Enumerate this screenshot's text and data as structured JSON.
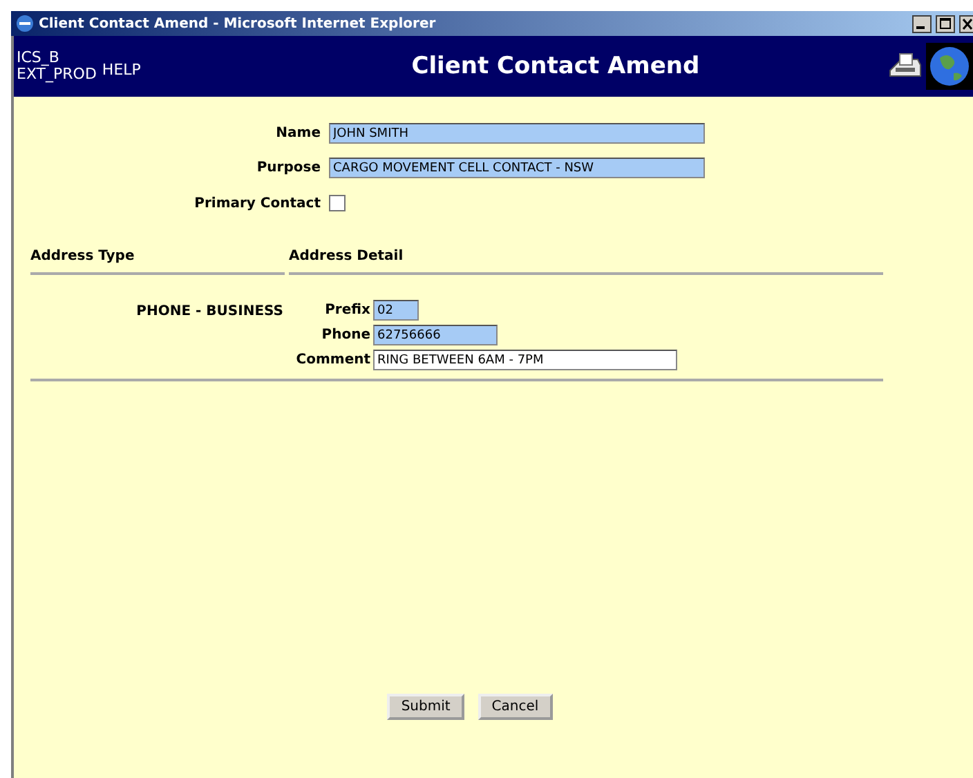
{
  "window": {
    "title": "Client Contact Amend - Microsoft Internet Explorer"
  },
  "header": {
    "system": "ICS_B",
    "environment": "EXT_PROD",
    "help": "HELP",
    "title": "Client Contact Amend"
  },
  "contact": {
    "name": {
      "label": "Name",
      "value": "JOHN SMITH",
      "highlighted": true
    },
    "purpose": {
      "label": "Purpose",
      "value": "CARGO MOVEMENT CELL CONTACT - NSW",
      "highlighted": true
    },
    "primary": {
      "label": "Primary Contact",
      "checked": false
    }
  },
  "addresses": {
    "columns": [
      "Address Type",
      "Address Detail"
    ],
    "rows": [
      {
        "type": "PHONE - BUSINESS",
        "fields": [
          {
            "label": "Prefix",
            "value": "02",
            "highlighted": true,
            "kind": "prefix"
          },
          {
            "label": "Phone",
            "value": "62756666",
            "highlighted": true,
            "kind": "phone"
          },
          {
            "label": "Comment",
            "value": "RING BETWEEN 6AM - 7PM",
            "highlighted": false,
            "kind": "comment"
          }
        ]
      }
    ]
  },
  "buttons": [
    "Submit",
    "Cancel"
  ]
}
